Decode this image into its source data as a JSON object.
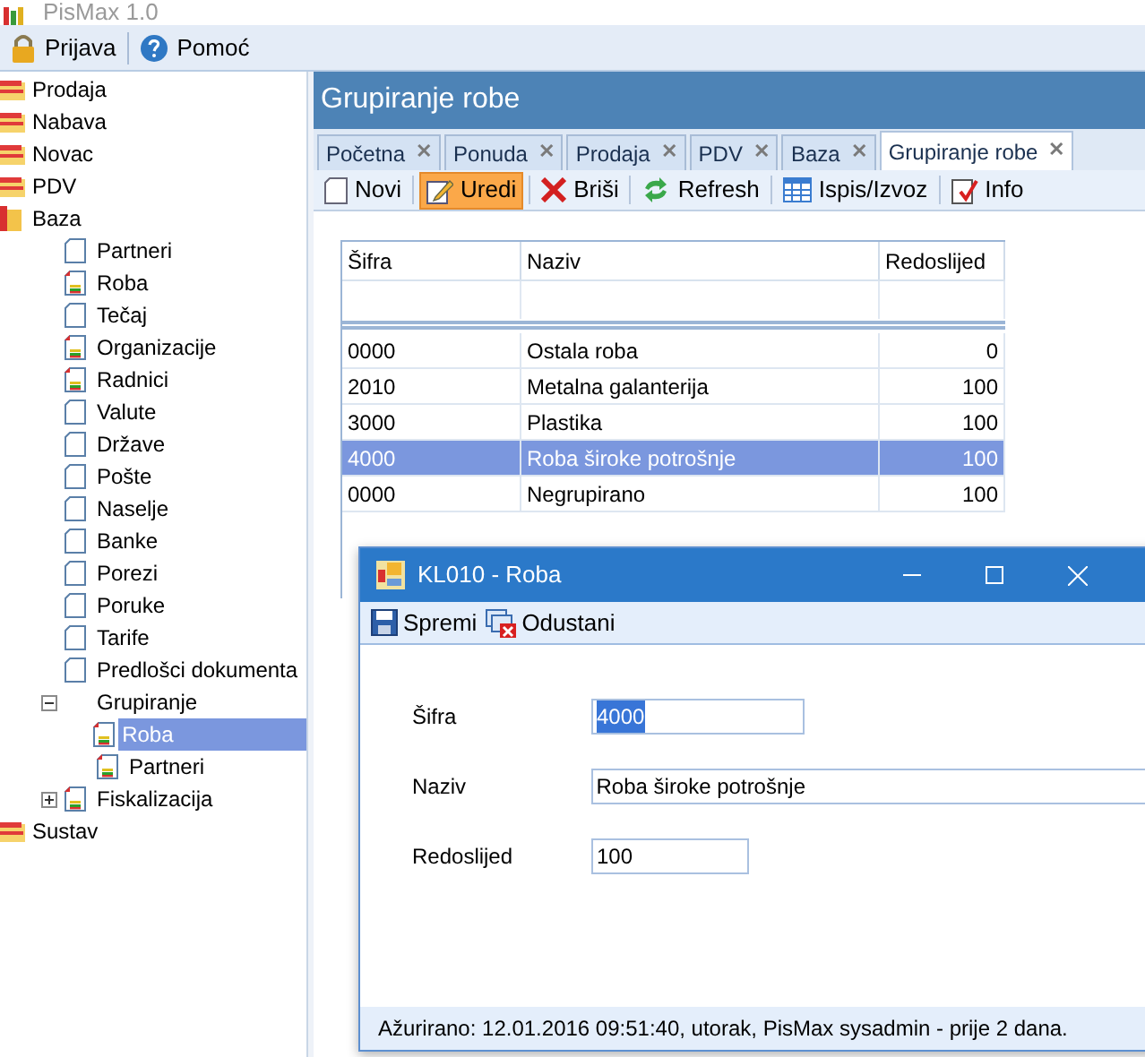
{
  "app_title": "PisMax 1.0",
  "menu": [
    {
      "label": "Prijava",
      "kind": "lock"
    },
    {
      "label": "Pomoć",
      "kind": "help"
    }
  ],
  "tree": [
    {
      "label": "Prodaja",
      "kind": "module",
      "selected": false
    },
    {
      "label": "Nabava",
      "kind": "module",
      "selected": false
    },
    {
      "label": "Novac",
      "kind": "module",
      "selected": false
    },
    {
      "label": "PDV",
      "kind": "module",
      "selected": false
    },
    {
      "label": "Baza",
      "kind": "book",
      "selected": false,
      "children": [
        {
          "label": "Partneri",
          "kind": "page",
          "selected": false
        },
        {
          "label": "Roba",
          "kind": "report",
          "selected": false
        },
        {
          "label": "Tečaj",
          "kind": "page",
          "selected": false
        },
        {
          "label": "Organizacije",
          "kind": "report",
          "selected": false
        },
        {
          "label": "Radnici",
          "kind": "report",
          "selected": false
        },
        {
          "label": "Valute",
          "kind": "page",
          "selected": false
        },
        {
          "label": "Države",
          "kind": "page",
          "selected": false
        },
        {
          "label": "Pošte",
          "kind": "page",
          "selected": false
        },
        {
          "label": "Naselje",
          "kind": "page",
          "selected": false
        },
        {
          "label": "Banke",
          "kind": "page",
          "selected": false
        },
        {
          "label": "Porezi",
          "kind": "page",
          "selected": false
        },
        {
          "label": "Poruke",
          "kind": "page",
          "selected": false
        },
        {
          "label": "Tarife",
          "kind": "page",
          "selected": false
        },
        {
          "label": "Predlošci dokumenta",
          "kind": "page",
          "selected": false
        },
        {
          "label": "Grupiranje",
          "kind": "group",
          "selected": false,
          "expanded": true,
          "children": [
            {
              "label": "Roba",
              "kind": "report",
              "selected": true
            },
            {
              "label": "Partneri",
              "kind": "report",
              "selected": false
            }
          ]
        },
        {
          "label": "Fiskalizacija",
          "kind": "report",
          "selected": false,
          "expanded": false
        }
      ]
    },
    {
      "label": "Sustav",
      "kind": "module",
      "selected": false
    }
  ],
  "panel_title": "Grupiranje robe",
  "tabs": [
    {
      "label": "Početna",
      "selected": false
    },
    {
      "label": "Ponuda",
      "selected": false
    },
    {
      "label": "Prodaja",
      "selected": false
    },
    {
      "label": "PDV",
      "selected": false
    },
    {
      "label": "Baza",
      "selected": false
    },
    {
      "label": "Grupiranje robe",
      "selected": true
    }
  ],
  "tab_close": "✕",
  "toolbar": [
    {
      "label": "Novi",
      "kind": "new",
      "selected": false
    },
    {
      "label": "Uredi",
      "kind": "edit",
      "selected": true
    },
    {
      "label": "Briši",
      "kind": "delete",
      "selected": false
    },
    {
      "label": "Refresh",
      "kind": "refresh",
      "selected": false
    },
    {
      "label": "Ispis/Izvoz",
      "kind": "table",
      "selected": false
    },
    {
      "label": "Info",
      "kind": "info",
      "selected": false
    }
  ],
  "table": {
    "columns": [
      "Šifra",
      "Naziv",
      "Redoslijed"
    ],
    "rows": [
      {
        "cells": [
          "0000",
          "Ostala roba",
          "0"
        ],
        "selected": false
      },
      {
        "cells": [
          "2010",
          "Metalna galanterija",
          "100"
        ],
        "selected": false
      },
      {
        "cells": [
          "3000",
          "Plastika",
          "100"
        ],
        "selected": false
      },
      {
        "cells": [
          "4000",
          "Roba široke potrošnje",
          "100"
        ],
        "selected": true
      },
      {
        "cells": [
          "0000",
          "Negrupirano",
          "100"
        ],
        "selected": false
      }
    ]
  },
  "dialog": {
    "title": "KL010 - Roba",
    "toolbar": [
      {
        "label": "Spremi",
        "kind": "save"
      },
      {
        "label": "Odustani",
        "kind": "cancel"
      }
    ],
    "fields": [
      {
        "label": "Šifra",
        "value": "4000",
        "text_selected": true
      },
      {
        "label": "Naziv",
        "value": "Roba široke potrošnje",
        "text_selected": false
      },
      {
        "label": "Redoslijed",
        "value": "100",
        "text_selected": false
      }
    ],
    "status_bar": "Ažurirano: 12.01.2016 09:51:40, utorak, PisMax sysadmin -  prije 2 dana."
  }
}
